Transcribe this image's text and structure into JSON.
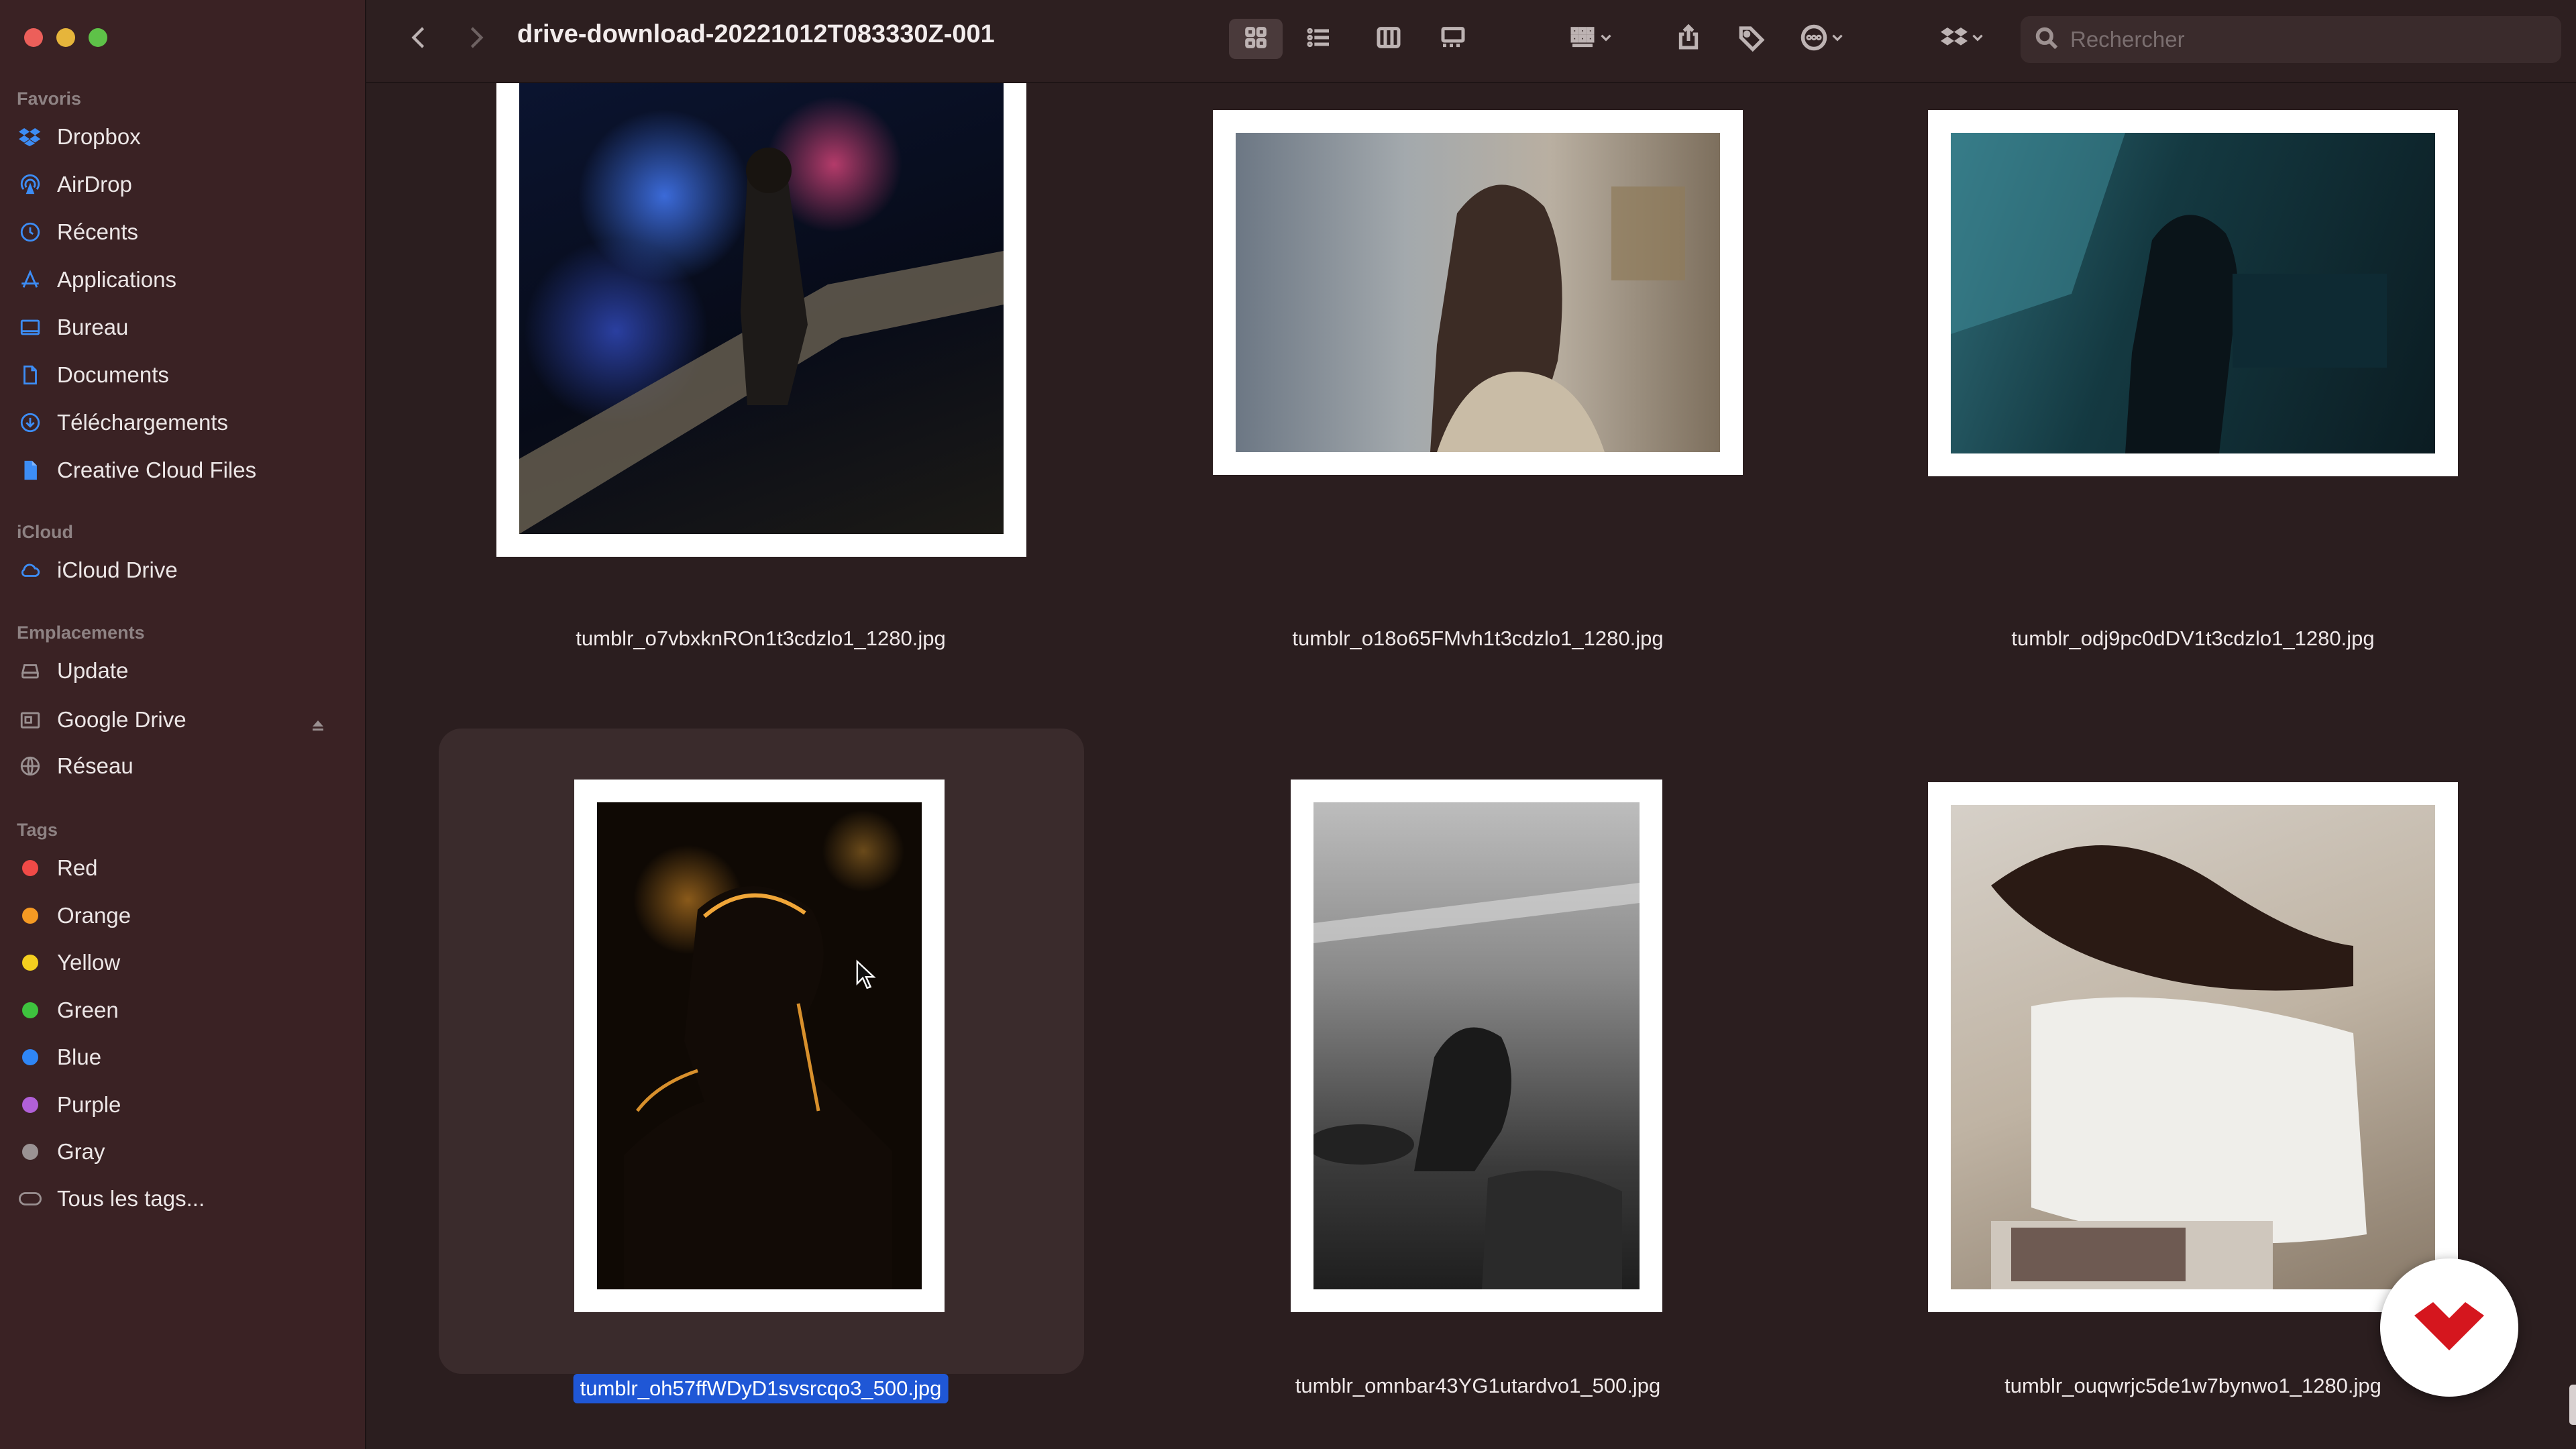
{
  "window": {
    "title": "drive-download-20221012T083330Z-001"
  },
  "sidebar": {
    "favorites_title": "Favoris",
    "favorites": [
      {
        "label": "Dropbox",
        "icon": "dropbox-icon"
      },
      {
        "label": "AirDrop",
        "icon": "airdrop-icon"
      },
      {
        "label": "Récents",
        "icon": "clock-icon"
      },
      {
        "label": "Applications",
        "icon": "applications-icon"
      },
      {
        "label": "Bureau",
        "icon": "desktop-icon"
      },
      {
        "label": "Documents",
        "icon": "document-icon"
      },
      {
        "label": "Téléchargements",
        "icon": "download-icon"
      },
      {
        "label": "Creative Cloud Files",
        "icon": "file-icon"
      }
    ],
    "icloud_title": "iCloud",
    "icloud": [
      {
        "label": "iCloud Drive",
        "icon": "cloud-icon"
      }
    ],
    "locations_title": "Emplacements",
    "locations": [
      {
        "label": "Update",
        "icon": "drive-icon"
      },
      {
        "label": "Google Drive",
        "icon": "drive-folder-icon"
      },
      {
        "label": "Réseau",
        "icon": "globe-icon"
      }
    ],
    "tags_title": "Tags",
    "tags": [
      {
        "label": "Red",
        "color": "#f04a47"
      },
      {
        "label": "Orange",
        "color": "#f59a23"
      },
      {
        "label": "Yellow",
        "color": "#f4cf1f"
      },
      {
        "label": "Green",
        "color": "#3ec33e"
      },
      {
        "label": "Blue",
        "color": "#2f86f6"
      },
      {
        "label": "Purple",
        "color": "#b160d8"
      },
      {
        "label": "Gray",
        "color": "#9a9293"
      }
    ],
    "all_tags": "Tous les tags..."
  },
  "toolbar": {
    "search_placeholder": "Rechercher"
  },
  "files": [
    {
      "name": "tumblr_o7vbxknROn1t3cdzlo1_1280.jpg",
      "orientation": "portrait",
      "selected": false
    },
    {
      "name": "tumblr_o18o65FMvh1t3cdzlo1_1280.jpg",
      "orientation": "landscape",
      "selected": false
    },
    {
      "name": "tumblr_odj9pc0dDV1t3cdzlo1_1280.jpg",
      "orientation": "landscape",
      "selected": false
    },
    {
      "name": "tumblr_oh57ffWDyD1svsrcqo3_500.jpg",
      "orientation": "portrait",
      "selected": true
    },
    {
      "name": "tumblr_omnbar43YG1utardvo1_500.jpg",
      "orientation": "portrait",
      "selected": false
    },
    {
      "name": "tumblr_ouqwrjc5de1w7bynwo1_1280.jpg",
      "orientation": "landscape",
      "selected": false
    }
  ]
}
